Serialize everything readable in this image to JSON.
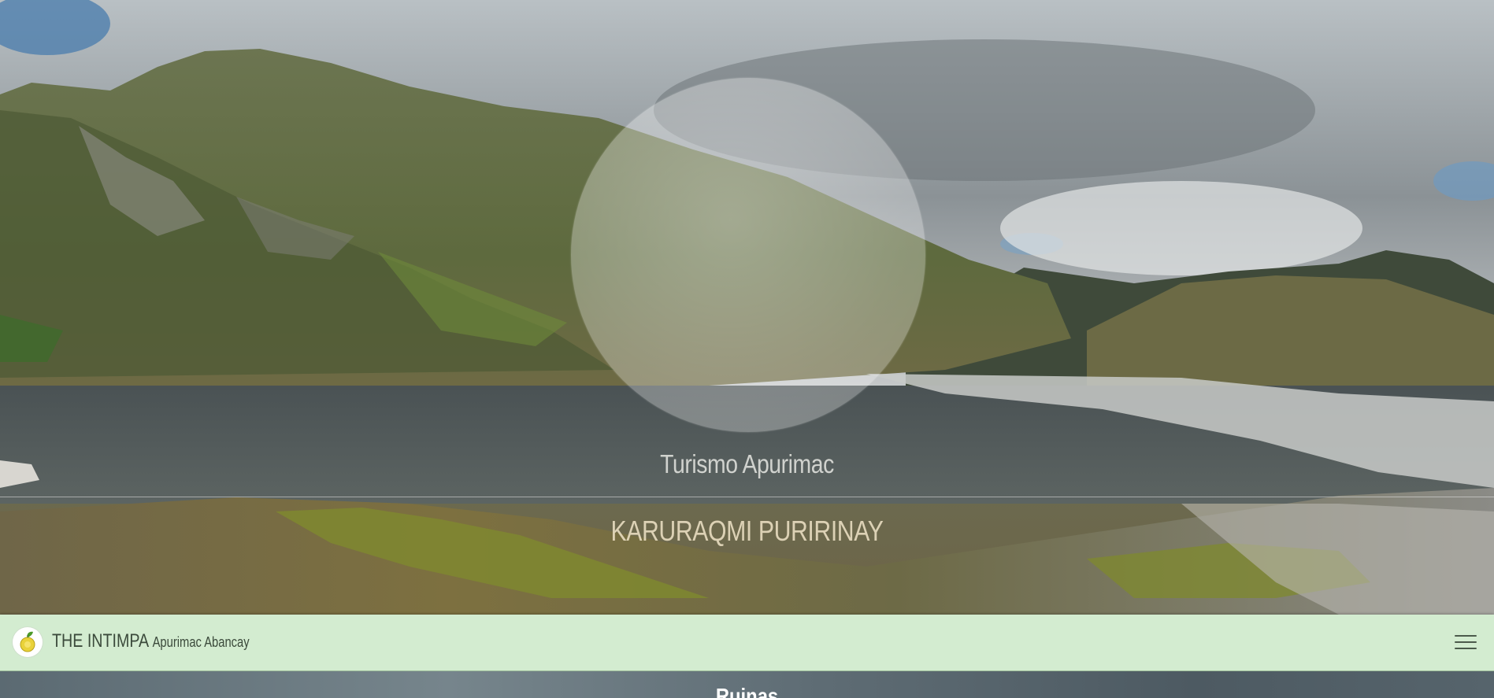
{
  "hero": {
    "subtitle": "Turismo Apurimac",
    "title": "KARURAQMI PURIRINAY"
  },
  "navbar": {
    "brand_name": "THE INTIMPA",
    "brand_tagline": "Apurimac Abancay",
    "logo_icon": "lemon-leaf-logo-icon",
    "menu_icon": "hamburger-menu-icon"
  },
  "next_section": {
    "heading": "Ruinas"
  },
  "colors": {
    "navbar_background": "#d3ecd0",
    "navbar_text": "#3b4a3b",
    "hero_text": "#f0e4c8"
  }
}
